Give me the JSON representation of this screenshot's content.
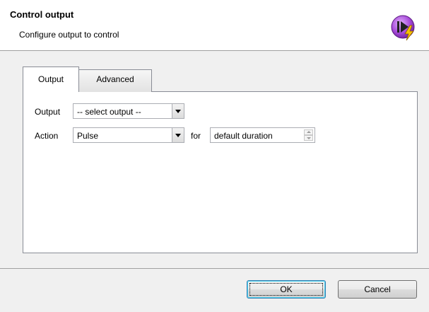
{
  "header": {
    "title": "Control output",
    "subtitle": "Configure output to control"
  },
  "tabs": [
    {
      "label": "Output",
      "active": true
    },
    {
      "label": "Advanced",
      "active": false
    }
  ],
  "form": {
    "output_label": "Output",
    "output_value": "-- select output --",
    "action_label": "Action",
    "action_value": "Pulse",
    "for_label": "for",
    "duration_value": "default duration"
  },
  "buttons": {
    "ok": "OK",
    "cancel": "Cancel"
  },
  "colors": {
    "icon_purple": "#8b35c9",
    "icon_lightning": "#f7c200"
  }
}
